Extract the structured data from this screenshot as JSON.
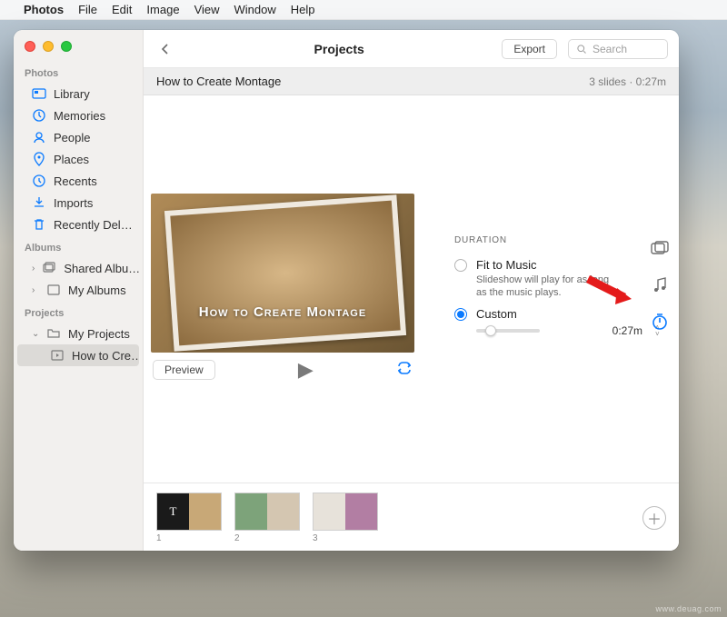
{
  "menubar": {
    "appname": "Photos",
    "items": [
      "File",
      "Edit",
      "Image",
      "View",
      "Window",
      "Help"
    ]
  },
  "sidebar": {
    "groups": [
      {
        "title": "Photos",
        "items": [
          {
            "icon": "library",
            "label": "Library"
          },
          {
            "icon": "memories",
            "label": "Memories"
          },
          {
            "icon": "people",
            "label": "People"
          },
          {
            "icon": "places",
            "label": "Places"
          },
          {
            "icon": "recents",
            "label": "Recents"
          },
          {
            "icon": "imports",
            "label": "Imports"
          },
          {
            "icon": "trash",
            "label": "Recently Del…"
          }
        ]
      },
      {
        "title": "Albums",
        "items": [
          {
            "icon": "shared",
            "label": "Shared Albu…",
            "chev": ">"
          },
          {
            "icon": "albums",
            "label": "My Albums",
            "chev": ">"
          }
        ]
      },
      {
        "title": "Projects",
        "items": [
          {
            "icon": "folder",
            "label": "My Projects",
            "chev": "v"
          },
          {
            "icon": "play",
            "label": "How to Cre…",
            "sub": true,
            "selected": true
          }
        ]
      }
    ]
  },
  "toolbar": {
    "title": "Projects",
    "export": "Export",
    "search_placeholder": "Search"
  },
  "project": {
    "name": "How to Create Montage",
    "meta": "3 slides · 0:27m",
    "caption": "How to Create Montage",
    "preview_btn": "Preview"
  },
  "panel": {
    "header": "DURATION",
    "fit_label": "Fit to Music",
    "fit_sub": "Slideshow will play for as long as the music plays.",
    "custom_label": "Custom",
    "time": "0:27m"
  },
  "thumbs": [
    "1",
    "2",
    "3"
  ],
  "watermark": "www.deuag.com"
}
